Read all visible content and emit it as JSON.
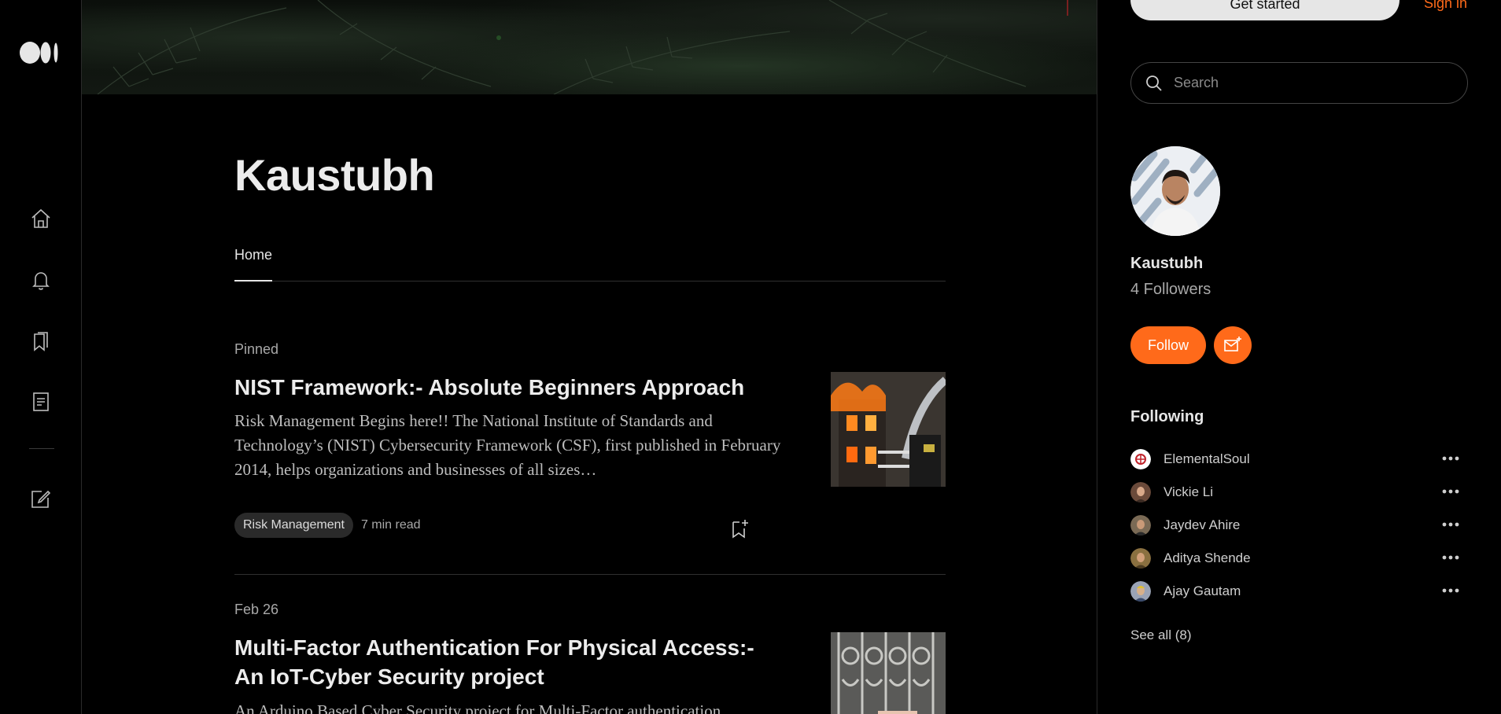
{
  "rail": {
    "icons": [
      "medium-logo",
      "home-icon",
      "bell-icon",
      "bookmarks-icon",
      "stories-icon",
      "write-icon"
    ]
  },
  "profile": {
    "name": "Kaustubh",
    "tab_home": "Home"
  },
  "posts": [
    {
      "meta": "Pinned",
      "title": "NIST Framework:- Absolute Beginners Approach",
      "excerpt": "Risk Management Begins here!! The National Institute of Standards and Technology’s (NIST) Cybersecurity Framework (CSF), first published in February 2014, helps organizations and businesses of all sizes…",
      "tag": "Risk Management",
      "read_time": "7 min read"
    },
    {
      "meta": "Feb 26",
      "title": "Multi-Factor Authentication For Physical Access:- An IoT-Cyber Security project",
      "excerpt": "An Arduino Based Cyber Security project for Multi-Factor authentication"
    }
  ],
  "sidebar": {
    "get_started": "Get started",
    "sign_in": "Sign in",
    "search_placeholder": "Search",
    "name": "Kaustubh",
    "followers": "4 Followers",
    "follow_label": "Follow",
    "following_title": "Following",
    "following": [
      {
        "name": "ElementalSoul",
        "color": "#ffffff"
      },
      {
        "name": "Vickie Li",
        "color": "#6b4a3a"
      },
      {
        "name": "Jaydev Ahire",
        "color": "#7a6a55"
      },
      {
        "name": "Aditya Shende",
        "color": "#8a7040"
      },
      {
        "name": "Ajay Gautam",
        "color": "#9aa3b5"
      }
    ],
    "see_all": "See all (8)"
  },
  "colors": {
    "accent": "#ff6a1a",
    "background": "#000000"
  }
}
